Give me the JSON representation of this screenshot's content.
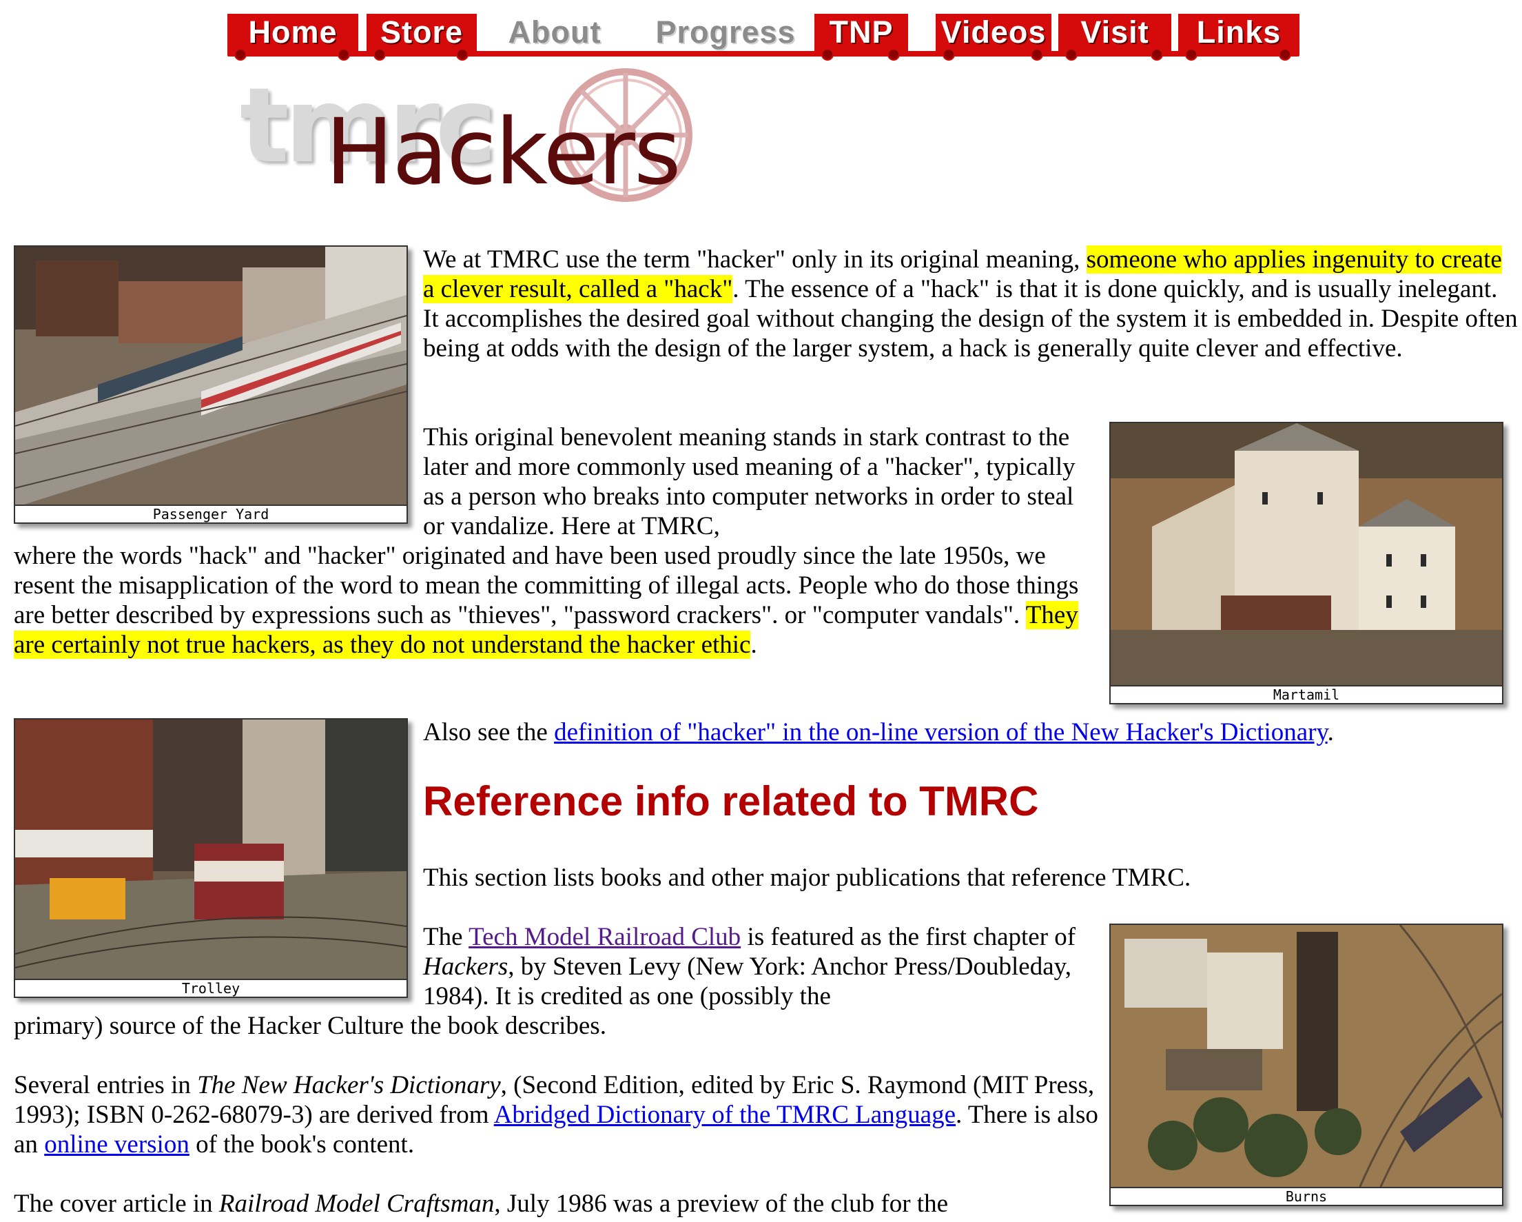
{
  "nav": {
    "items": [
      {
        "label": "Home"
      },
      {
        "label": "Store"
      },
      {
        "label": "About"
      },
      {
        "label": "Progress"
      },
      {
        "label": "TNP"
      },
      {
        "label": "Videos"
      },
      {
        "label": "Visit"
      },
      {
        "label": "Links"
      }
    ]
  },
  "logo": {
    "ghost_text": "tmrc",
    "title": "Hackers"
  },
  "photos": {
    "passenger": "Passenger Yard",
    "martamil": "Martamil",
    "trolley": "Trolley",
    "burns": "Burns"
  },
  "p1": {
    "a": "We at TMRC use the term \"hacker\" only in its original meaning, ",
    "hl": "someone who applies ingenuity to create a clever result, called a \"hack\"",
    "b": ". The essence of a \"hack\" is that it is done quickly, and is usually inelegant. It accomplishes the desired goal without changing the design of the system it is embedded in. Despite often being at odds with the design of the larger system, a hack is generally quite clever and effective."
  },
  "p2": {
    "a": "This original benevolent meaning stands in stark contrast to the later and more commonly used meaning of a \"hacker\", typically as a person who breaks into computer networks in order to steal or vandalize. Here at TMRC,",
    "b": "where the words \"hack\" and \"hacker\" originated and have been used proudly since the late 1950s, we resent the misapplication of the word to mean the committing of illegal acts. People who do those things are better described by expressions such as \"thieves\", \"password crackers\". or \"computer vandals\". ",
    "hl": "They are certainly not true hackers, as they do not understand the hacker ethic",
    "c": "."
  },
  "p3": {
    "a": "Also see the ",
    "link": "definition of \"hacker\" in the on-line version of the New Hacker's Dictionary",
    "b": "."
  },
  "heading": "Reference info related to TMRC",
  "p4": "This section lists books and other major publications that reference TMRC.",
  "p5": {
    "a": "The ",
    "link": "Tech Model Railroad Club",
    "b": " is featured as the first chapter of ",
    "i": "Hackers",
    "c": ", by Steven Levy (New York: Anchor Press/Doubleday, 1984). It is credited as one (possibly the",
    "d": "primary) source of the Hacker Culture the book describes."
  },
  "p6": {
    "a": "Several entries in ",
    "i": "The New Hacker's Dictionary",
    "b": ", (Second Edition, edited by Eric S. Raymond (MIT Press, 1993); ISBN 0-262-68079-3) are derived from ",
    "link1": "Abridged Dictionary of the TMRC Language",
    "c": ". There is also an ",
    "link2": "online version",
    "d": " of the book's content."
  },
  "p7": {
    "a": "The cover article in ",
    "i": "Railroad Model Craftsman",
    "b": ", July 1986 was a preview of the club for the"
  }
}
